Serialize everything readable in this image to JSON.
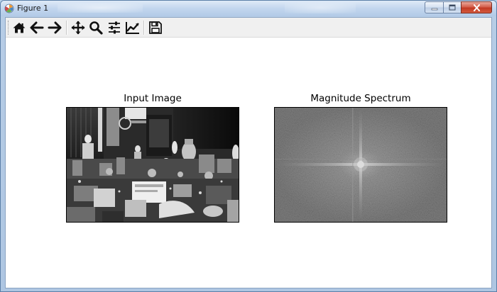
{
  "window": {
    "title": "Figure 1"
  },
  "toolbar": {
    "buttons": [
      {
        "name": "home",
        "icon": "home-icon"
      },
      {
        "name": "back",
        "icon": "arrow-left-icon"
      },
      {
        "name": "forward",
        "icon": "arrow-right-icon"
      },
      {
        "name": "pan",
        "icon": "move-icon"
      },
      {
        "name": "zoom",
        "icon": "magnifier-icon"
      },
      {
        "name": "configure-subplots",
        "icon": "sliders-icon"
      },
      {
        "name": "edit-axis",
        "icon": "line-chart-icon"
      },
      {
        "name": "save",
        "icon": "floppy-disk-icon"
      }
    ]
  },
  "figure": {
    "left_axes": {
      "title": "Input Image"
    },
    "right_axes": {
      "title": "Magnitude Spectrum"
    }
  },
  "colors": {
    "frame": "#b9d1ea",
    "toolbar": "#f0f0f0",
    "close_button": "#c94a33"
  }
}
